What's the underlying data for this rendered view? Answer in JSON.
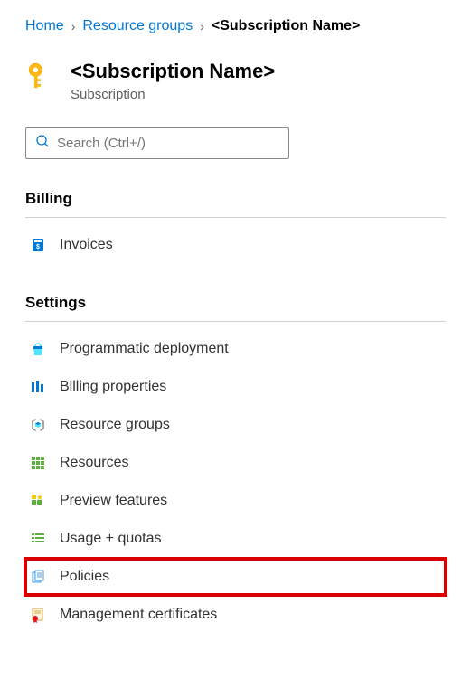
{
  "breadcrumb": {
    "home": "Home",
    "resource_groups": "Resource groups",
    "current": "<Subscription Name>"
  },
  "header": {
    "title": "<Subscription Name>",
    "subtitle": "Subscription"
  },
  "search": {
    "placeholder": "Search (Ctrl+/)"
  },
  "sections": {
    "billing": {
      "title": "Billing",
      "items": [
        {
          "label": "Invoices"
        }
      ]
    },
    "settings": {
      "title": "Settings",
      "items": [
        {
          "label": "Programmatic deployment"
        },
        {
          "label": "Billing properties"
        },
        {
          "label": "Resource groups"
        },
        {
          "label": "Resources"
        },
        {
          "label": "Preview features"
        },
        {
          "label": "Usage + quotas"
        },
        {
          "label": "Policies"
        },
        {
          "label": "Management certificates"
        }
      ]
    }
  }
}
